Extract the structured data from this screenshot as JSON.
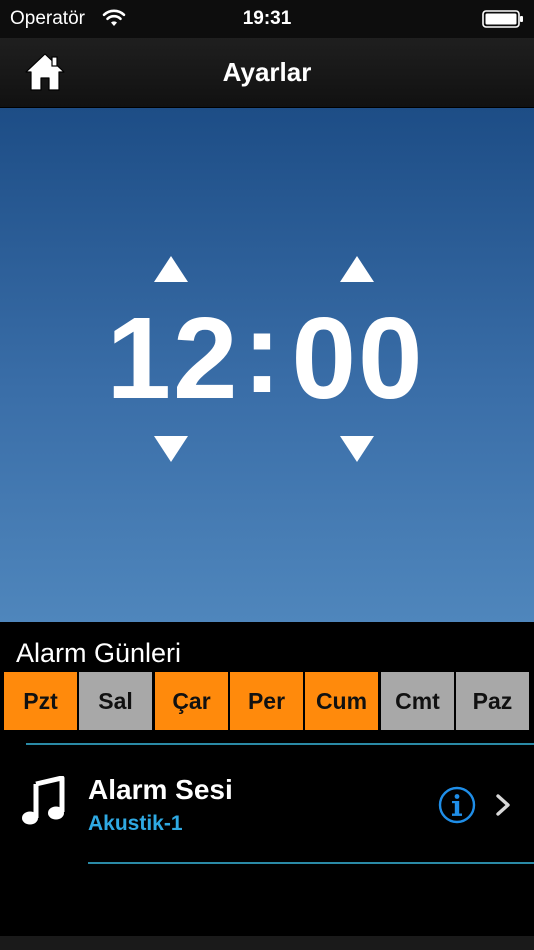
{
  "status_bar": {
    "carrier": "Operatör",
    "time": "19:31",
    "wifi_icon": "wifi-icon",
    "battery_icon": "battery-icon"
  },
  "nav_bar": {
    "title": "Ayarlar",
    "home_icon": "home-icon"
  },
  "clock": {
    "hours": "12",
    "separator": ":",
    "minutes": "00",
    "up_icon": "triangle-up-icon",
    "down_icon": "triangle-down-icon"
  },
  "alarm_days": {
    "title": "Alarm Günleri",
    "days": [
      {
        "label": "Pzt",
        "active": true
      },
      {
        "label": "Sal",
        "active": false
      },
      {
        "label": "Çar",
        "active": true
      },
      {
        "label": "Per",
        "active": true
      },
      {
        "label": "Cum",
        "active": true
      },
      {
        "label": "Cmt",
        "active": false
      },
      {
        "label": "Paz",
        "active": false
      }
    ]
  },
  "alarm_sound": {
    "title": "Alarm Sesi",
    "value": "Akustik-1",
    "music_icon": "music-note-icon",
    "info_icon": "info-icon",
    "chevron_icon": "chevron-right-icon"
  },
  "colors": {
    "active_day": "#ff8a0c",
    "inactive_day": "#a8a8a8",
    "accent_blue": "#2fa9e2",
    "divider": "#2a8aa6",
    "panel_top": "#1d4d86",
    "panel_bottom": "#4f86bc"
  }
}
